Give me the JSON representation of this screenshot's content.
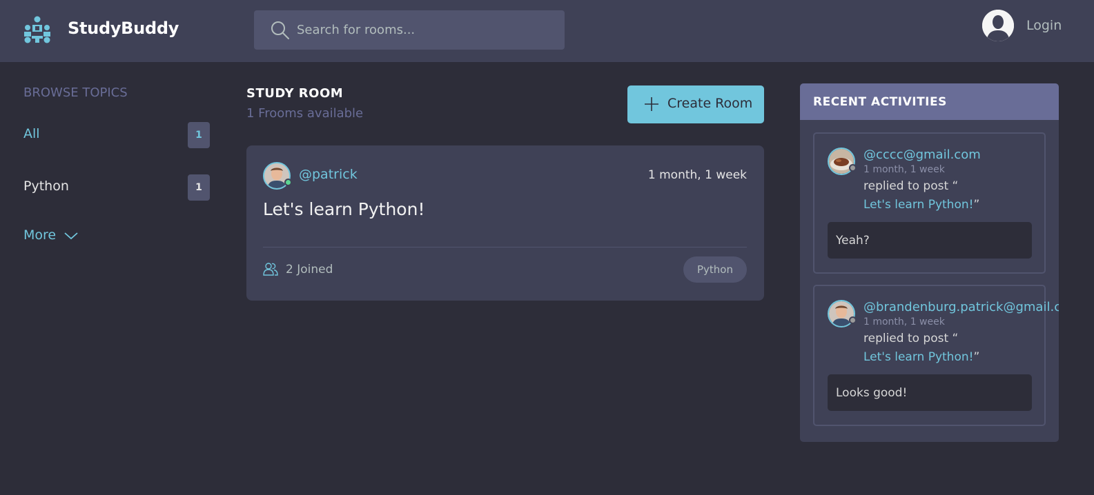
{
  "header": {
    "brand": "StudyBuddy",
    "search_placeholder": "Search for rooms...",
    "login_label": "Login"
  },
  "topics": {
    "title": "Browse Topics",
    "items": [
      {
        "label": "All",
        "count": "1",
        "color": "#71c6dd"
      },
      {
        "label": "Python",
        "count": "1",
        "color": "#e5e5e5"
      }
    ],
    "more_label": "More"
  },
  "study_room": {
    "title": "Study Room",
    "subtitle": "1 Frooms available",
    "create_label": "Create Room",
    "rooms": [
      {
        "host": "@patrick",
        "time": "1 month, 1 week",
        "title": "Let's learn Python!",
        "joined": "2 Joined",
        "topic": "Python"
      }
    ]
  },
  "activities": {
    "title": "Recent Activities",
    "items": [
      {
        "user": "@cccc@gmail.com",
        "time": "1 month, 1 week",
        "action": "replied to post “",
        "post": "Let's learn Python!",
        "post_close": "”",
        "message": "Yeah?"
      },
      {
        "user": "@brandenburg.patrick@gmail.com",
        "time": "1 month, 1 week",
        "action": "replied to post “",
        "post": "Let's learn Python!",
        "post_close": "”",
        "message": "Looks good!"
      }
    ]
  },
  "colors": {
    "background": "#2d2d39",
    "surface": "#3f4156",
    "accent": "#71c6dd",
    "muted": "#696d97"
  }
}
